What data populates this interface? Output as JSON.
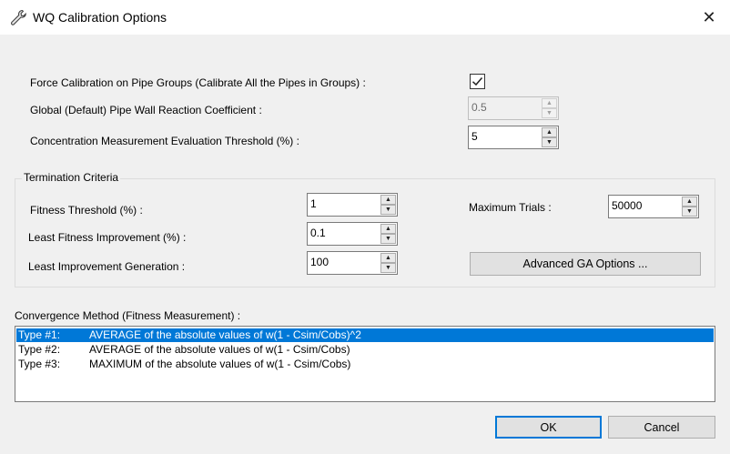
{
  "window": {
    "title": "WQ Calibration Options",
    "close_glyph": "✕"
  },
  "options": {
    "force_calibration_label": "Force Calibration on Pipe Groups (Calibrate All the Pipes in Groups) :",
    "force_calibration_checked": true,
    "wall_coeff_label": "Global (Default) Pipe Wall Reaction Coefficient :",
    "wall_coeff_value": "0.5",
    "threshold_label": "Concentration Measurement Evaluation Threshold (%) :",
    "threshold_value": "5"
  },
  "termination": {
    "title": "Termination Criteria",
    "fitness_threshold_label": "Fitness Threshold (%) :",
    "fitness_threshold_value": "1",
    "least_fitness_label": "Least Fitness Improvement (%) :",
    "least_fitness_value": "0.1",
    "least_generation_label": "Least Improvement Generation :",
    "least_generation_value": "100",
    "max_trials_label": "Maximum Trials :",
    "max_trials_value": "50000",
    "advanced_button": "Advanced GA Options ..."
  },
  "convergence": {
    "label": "Convergence Method (Fitness Measurement) :",
    "items": [
      {
        "type": "Type #1:",
        "desc": "AVERAGE of the absolute values of w(1 - Csim/Cobs)^2",
        "selected": true
      },
      {
        "type": "Type #2:",
        "desc": "AVERAGE of the absolute values of w(1 - Csim/Cobs)",
        "selected": false
      },
      {
        "type": "Type #3:",
        "desc": "MAXIMUM of the absolute values of w(1 - Csim/Cobs)",
        "selected": false
      }
    ]
  },
  "buttons": {
    "ok": "OK",
    "cancel": "Cancel"
  },
  "colors": {
    "selection": "#0078d7",
    "default_button_border": "#0078d7"
  },
  "icons": {
    "title": "wrench-icon",
    "close": "close-icon",
    "spin_up": "spin-up-icon",
    "spin_down": "spin-down-icon",
    "check": "checkmark-icon"
  }
}
